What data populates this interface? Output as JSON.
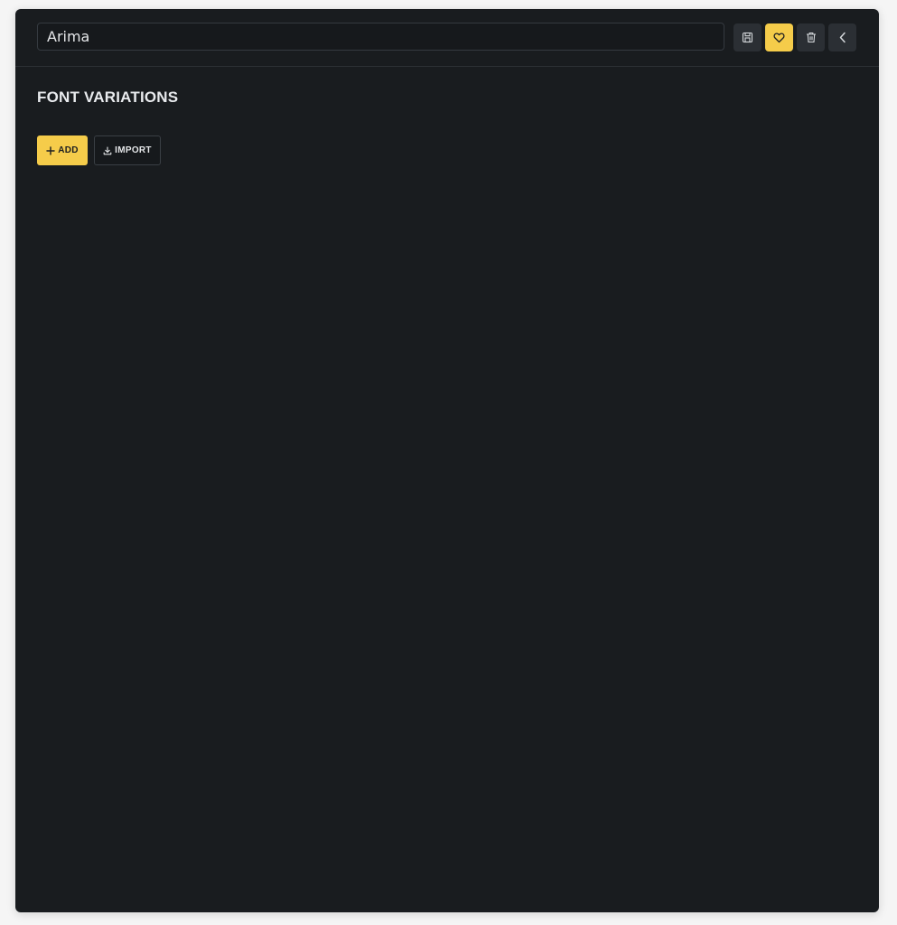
{
  "header": {
    "font_name_value": "Arima",
    "buttons": {
      "save_icon": "save-icon",
      "favorite_icon": "heart-icon",
      "delete_icon": "trash-icon",
      "back_icon": "chevron-left-icon"
    }
  },
  "main": {
    "section_title": "FONT VARIATIONS",
    "add_label": "ADD",
    "import_label": "IMPORT"
  },
  "colors": {
    "panel_bg": "#191c1f",
    "accent": "#f5cc4a",
    "icon_button_bg": "#2b2f34"
  }
}
